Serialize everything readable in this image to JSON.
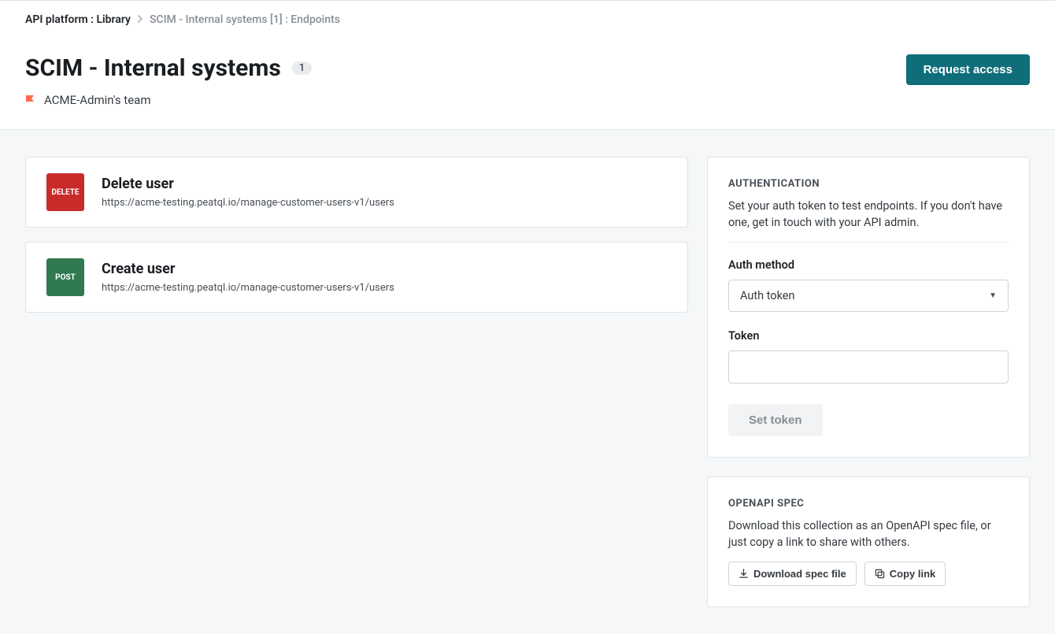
{
  "breadcrumb": {
    "root": "API platform : Library",
    "current": "SCIM - Internal systems [1] : Endpoints"
  },
  "header": {
    "title": "SCIM - Internal systems",
    "count": "1",
    "team": "ACME-Admin's team",
    "request_access": "Request access"
  },
  "endpoints": [
    {
      "method": "DELETE",
      "method_class": "method-delete",
      "title": "Delete user",
      "url": "https://acme-testing.peatql.io/manage-customer-users-v1/users"
    },
    {
      "method": "POST",
      "method_class": "method-post",
      "title": "Create user",
      "url": "https://acme-testing.peatql.io/manage-customer-users-v1/users"
    }
  ],
  "auth": {
    "heading": "AUTHENTICATION",
    "desc": "Set your auth token to test endpoints. If you don't have one, get in touch with your API admin.",
    "method_label": "Auth method",
    "method_value": "Auth token",
    "token_label": "Token",
    "set_token": "Set token"
  },
  "spec": {
    "heading": "OPENAPI SPEC",
    "desc": "Download this collection as an OpenAPI spec file, or just copy a link to share with others.",
    "download": "Download spec file",
    "copy": "Copy link"
  }
}
